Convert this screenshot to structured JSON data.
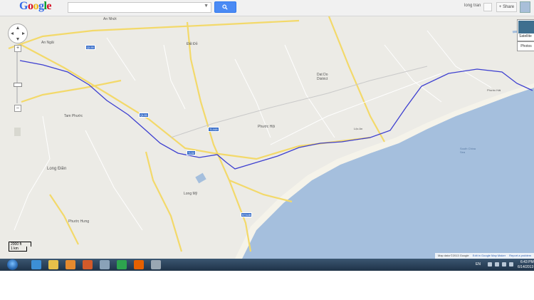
{
  "topbar": {
    "logo_letters": [
      {
        "ch": "G",
        "color": "#3369e8"
      },
      {
        "ch": "o",
        "color": "#d50f25"
      },
      {
        "ch": "o",
        "color": "#eeb211"
      },
      {
        "ch": "g",
        "color": "#3369e8"
      },
      {
        "ch": "l",
        "color": "#009925"
      },
      {
        "ch": "e",
        "color": "#d50f25"
      }
    ],
    "search_value": "",
    "user_name": "long tran",
    "share_label": "+ Share"
  },
  "map": {
    "labels": [
      {
        "id": "an-nhut",
        "text": "An Nhứt"
      },
      {
        "id": "an-ngai",
        "text": "An Ngãi"
      },
      {
        "id": "tam-phuoc",
        "text": "Tam Phước"
      },
      {
        "id": "long-dien",
        "text": "Long Điền"
      },
      {
        "id": "phuoc-hung",
        "text": "Phước Hưng"
      },
      {
        "id": "long-my",
        "text": "Long Mỹ"
      },
      {
        "id": "phuoc-hoi",
        "text": "Phước Hội"
      },
      {
        "id": "dat-do",
        "text": "Đất Đỏ"
      },
      {
        "id": "dat-do-district",
        "text": "Dat Do District"
      },
      {
        "id": "south-china-sea",
        "text": "South China Sea"
      },
      {
        "id": "loc-an",
        "text": "Lộc An"
      },
      {
        "id": "phuoc-hai",
        "text": "Phước Hải"
      }
    ],
    "shields": [
      {
        "id": "ql55-a",
        "text": "QL55"
      },
      {
        "id": "ql55-b",
        "text": "QL55"
      },
      {
        "id": "tl44a",
        "text": "TL44A"
      },
      {
        "id": "tl52",
        "text": "TL52"
      },
      {
        "id": "dt44b",
        "text": "ĐT44B"
      }
    ],
    "controls": {
      "satellite_label": "Satellite",
      "photos_label": "Photos",
      "zoom_in": "+",
      "zoom_out": "–"
    },
    "scale": {
      "top": "2000 ft",
      "bottom": "1 km"
    },
    "footer": {
      "attribution": "Map data ©2013 Google",
      "edit_link": "Edit in Google Map Maker",
      "report_link": "Report a problem"
    },
    "route_color": "#3d3fd0",
    "sea_color": "#a5bfdd"
  },
  "taskbar": {
    "apps": [
      {
        "id": "ie",
        "icon": "internet-explorer-icon",
        "color": "#3c8fd6"
      },
      {
        "id": "explorer",
        "icon": "folder-icon",
        "color": "#e7c04a"
      },
      {
        "id": "media",
        "icon": "media-player-icon",
        "color": "#e58a2e"
      },
      {
        "id": "app4",
        "icon": "toolbox-icon",
        "color": "#d35a2a"
      },
      {
        "id": "app5",
        "icon": "network-icon",
        "color": "#8aa2b8"
      },
      {
        "id": "chrome",
        "icon": "chrome-icon",
        "color": "#2da44e"
      },
      {
        "id": "firefox",
        "icon": "firefox-icon",
        "color": "#e66000"
      },
      {
        "id": "app8",
        "icon": "viewer-icon",
        "color": "#9aa7b3"
      }
    ],
    "language": "EN",
    "time": "6:43 PM",
    "date": "6/14/2013"
  }
}
